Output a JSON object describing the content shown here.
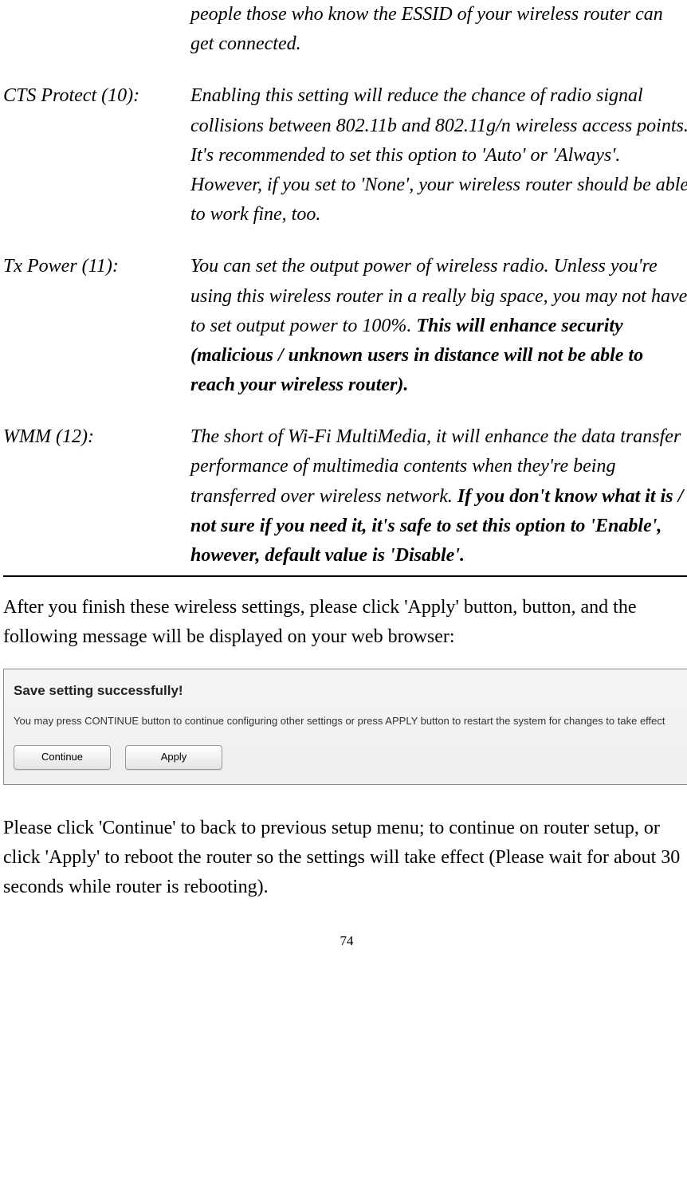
{
  "definitions": {
    "row0": {
      "term": "",
      "desc_pre": "people those who know the ESSID of your wireless router can get connected.",
      "desc_bold": ""
    },
    "row1": {
      "term": "CTS Protect (10):",
      "desc_pre": "Enabling this setting will reduce the chance of radio signal collisions between 802.11b and 802.11g/n wireless access points. It's recommended to set this option to 'Auto' or 'Always'. However, if you set to 'None', your wireless router should be able to work fine, too.",
      "desc_bold": ""
    },
    "row2": {
      "term": "Tx Power (11):",
      "desc_pre": "You can set the output power of wireless radio. Unless you're using this wireless router in a really big space, you may not have to set output power to 100%. ",
      "desc_bold": "This will enhance security (malicious / unknown users in distance will not be able to reach your wireless router)."
    },
    "row3": {
      "term": "WMM (12):",
      "desc_pre": "The short of Wi-Fi MultiMedia, it will enhance the data transfer performance of multimedia contents when they're being transferred over wireless network. ",
      "desc_bold": "If you don't know what it is / not sure if you need it, it's safe to set this option to 'Enable', however, default value is 'Disable'."
    }
  },
  "para1": "After you finish these wireless settings, please click 'Apply' button, button, and the following message will be displayed on your web browser:",
  "screenshot": {
    "title": "Save setting successfully!",
    "text": "You may press CONTINUE button to continue configuring other settings or press APPLY button to restart the system for changes to take effect",
    "buttons": {
      "continue": "Continue",
      "apply": "Apply"
    }
  },
  "para2": "Please click 'Continue' to back to previous setup menu; to continue on router setup, or click 'Apply' to reboot the router so the settings will take effect (Please wait for about 30 seconds while router is rebooting).",
  "page_number": "74"
}
